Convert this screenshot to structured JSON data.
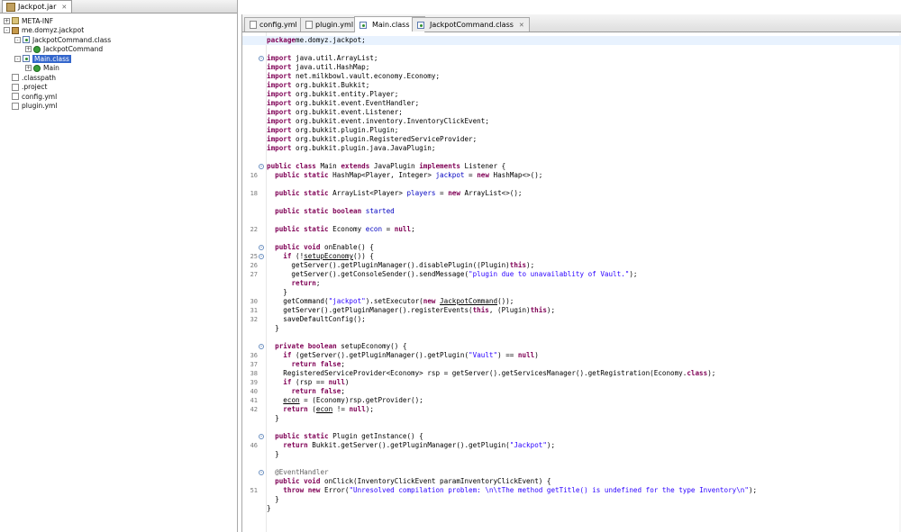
{
  "left_tab": {
    "label": "Jackpot.jar"
  },
  "tree": [
    {
      "label": "META-INF",
      "depth": 0,
      "icon": "package-folder-icon",
      "expander": "+"
    },
    {
      "label": "me.domyz.jackpot",
      "depth": 0,
      "icon": "package-icon",
      "expander": "-"
    },
    {
      "label": "JackpotCommand.class",
      "depth": 1,
      "icon": "class-file-icon",
      "expander": "-"
    },
    {
      "label": "JackpotCommand",
      "depth": 2,
      "icon": "class-icon",
      "expander": "+"
    },
    {
      "label": "Main.class",
      "depth": 1,
      "icon": "class-file-icon",
      "expander": "-",
      "selected": true
    },
    {
      "label": "Main",
      "depth": 2,
      "icon": "class-icon",
      "expander": "+"
    },
    {
      "label": ".classpath",
      "depth": 0,
      "icon": "file-icon",
      "expander": ""
    },
    {
      "label": ".project",
      "depth": 0,
      "icon": "file-icon",
      "expander": ""
    },
    {
      "label": "config.yml",
      "depth": 0,
      "icon": "file-icon",
      "expander": ""
    },
    {
      "label": "plugin.yml",
      "depth": 0,
      "icon": "file-icon",
      "expander": ""
    }
  ],
  "editor_tabs": [
    {
      "label": "config.yml",
      "active": false
    },
    {
      "label": "plugin.yml",
      "active": false
    },
    {
      "label": "Main.class",
      "active": true
    },
    {
      "label": "JackpotCommand.class",
      "active": false
    }
  ],
  "code_lines": [
    {
      "n": "",
      "fold": "",
      "hl": true,
      "segs": [
        [
          "kw",
          "package"
        ],
        [
          "",
          "me.domyz.jackpot;"
        ]
      ]
    },
    {
      "n": "",
      "fold": "",
      "segs": []
    },
    {
      "n": "",
      "fold": "-",
      "segs": [
        [
          "kw",
          "import"
        ],
        [
          "",
          " java.util.ArrayList;"
        ]
      ]
    },
    {
      "n": "",
      "fold": "",
      "segs": [
        [
          "kw",
          "import"
        ],
        [
          "",
          " java.util.HashMap;"
        ]
      ]
    },
    {
      "n": "",
      "fold": "",
      "segs": [
        [
          "kw",
          "import"
        ],
        [
          "",
          " net.milkbowl.vault.economy.Economy;"
        ]
      ]
    },
    {
      "n": "",
      "fold": "",
      "segs": [
        [
          "kw",
          "import"
        ],
        [
          "",
          " org.bukkit.Bukkit;"
        ]
      ]
    },
    {
      "n": "",
      "fold": "",
      "segs": [
        [
          "kw",
          "import"
        ],
        [
          "",
          " org.bukkit.entity.Player;"
        ]
      ]
    },
    {
      "n": "",
      "fold": "",
      "segs": [
        [
          "kw",
          "import"
        ],
        [
          "",
          " org.bukkit.event.EventHandler;"
        ]
      ]
    },
    {
      "n": "",
      "fold": "",
      "segs": [
        [
          "kw",
          "import"
        ],
        [
          "",
          " org.bukkit.event.Listener;"
        ]
      ]
    },
    {
      "n": "",
      "fold": "",
      "segs": [
        [
          "kw",
          "import"
        ],
        [
          "",
          " org.bukkit.event.inventory.InventoryClickEvent;"
        ]
      ]
    },
    {
      "n": "",
      "fold": "",
      "segs": [
        [
          "kw",
          "import"
        ],
        [
          "",
          " org.bukkit.plugin.Plugin;"
        ]
      ]
    },
    {
      "n": "",
      "fold": "",
      "segs": [
        [
          "kw",
          "import"
        ],
        [
          "",
          " org.bukkit.plugin.RegisteredServiceProvider;"
        ]
      ]
    },
    {
      "n": "",
      "fold": "",
      "segs": [
        [
          "kw",
          "import"
        ],
        [
          "",
          " org.bukkit.plugin.java.JavaPlugin;"
        ]
      ]
    },
    {
      "n": "",
      "fold": "",
      "segs": []
    },
    {
      "n": "",
      "fold": "-",
      "segs": [
        [
          "kw",
          "public class"
        ],
        [
          "",
          " Main "
        ],
        [
          "kw",
          "extends"
        ],
        [
          "",
          " JavaPlugin "
        ],
        [
          "kw",
          "implements"
        ],
        [
          "",
          " Listener {"
        ]
      ]
    },
    {
      "n": "16",
      "fold": "",
      "segs": [
        [
          "",
          "  "
        ],
        [
          "kw",
          "public static"
        ],
        [
          "",
          " HashMap<Player, Integer> "
        ],
        [
          "fld",
          "jackpot"
        ],
        [
          "",
          " = "
        ],
        [
          "kw",
          "new"
        ],
        [
          "",
          " HashMap<>();"
        ]
      ]
    },
    {
      "n": "",
      "fold": "",
      "segs": []
    },
    {
      "n": "18",
      "fold": "",
      "segs": [
        [
          "",
          "  "
        ],
        [
          "kw",
          "public static"
        ],
        [
          "",
          " ArrayList<Player> "
        ],
        [
          "fld",
          "players"
        ],
        [
          "",
          " = "
        ],
        [
          "kw",
          "new"
        ],
        [
          "",
          " ArrayList<>();"
        ]
      ]
    },
    {
      "n": "",
      "fold": "",
      "segs": []
    },
    {
      "n": "",
      "fold": "",
      "segs": [
        [
          "",
          "  "
        ],
        [
          "kw",
          "public static boolean"
        ],
        [
          "",
          " "
        ],
        [
          "fld",
          "started"
        ],
        [
          ";",
          " "
        ]
      ]
    },
    {
      "n": "",
      "fold": "",
      "segs": []
    },
    {
      "n": "22",
      "fold": "",
      "segs": [
        [
          "",
          "  "
        ],
        [
          "kw",
          "public static"
        ],
        [
          "",
          " Economy "
        ],
        [
          "fld",
          "econ"
        ],
        [
          "",
          " = "
        ],
        [
          "kw",
          "null"
        ],
        [
          "",
          ";"
        ]
      ]
    },
    {
      "n": "",
      "fold": "",
      "segs": []
    },
    {
      "n": "",
      "fold": "-",
      "segs": [
        [
          "",
          "  "
        ],
        [
          "kw",
          "public void"
        ],
        [
          "",
          " onEnable() {"
        ]
      ]
    },
    {
      "n": "25",
      "fold": "-",
      "segs": [
        [
          "",
          "    "
        ],
        [
          "kw",
          "if"
        ],
        [
          "",
          " (!"
        ],
        [
          "ul",
          "setupEconomy"
        ],
        [
          "",
          "()) {"
        ]
      ]
    },
    {
      "n": "26",
      "fold": "",
      "segs": [
        [
          "",
          "      getServer().getPluginManager().disablePlugin((Plugin)"
        ],
        [
          "kw",
          "this"
        ],
        [
          "",
          ");"
        ]
      ]
    },
    {
      "n": "27",
      "fold": "",
      "segs": [
        [
          "",
          "      getServer().getConsoleSender().sendMessage("
        ],
        [
          "str",
          "\"plugin due to unavailablity of Vault.\""
        ],
        [
          "",
          ");"
        ]
      ]
    },
    {
      "n": "",
      "fold": "",
      "segs": [
        [
          "",
          "      "
        ],
        [
          "kw",
          "return"
        ],
        [
          "",
          ";"
        ]
      ]
    },
    {
      "n": "",
      "fold": "",
      "segs": [
        [
          "",
          "    }"
        ]
      ]
    },
    {
      "n": "30",
      "fold": "",
      "segs": [
        [
          "",
          "    getCommand("
        ],
        [
          "str",
          "\"jackpot\""
        ],
        [
          "",
          ").setExecutor("
        ],
        [
          "kw",
          "new"
        ],
        [
          "",
          " "
        ],
        [
          "ul",
          "JackpotCommand"
        ],
        [
          "",
          "());"
        ]
      ]
    },
    {
      "n": "31",
      "fold": "",
      "segs": [
        [
          "",
          "    getServer().getPluginManager().registerEvents("
        ],
        [
          "kw",
          "this"
        ],
        [
          "",
          ", (Plugin)"
        ],
        [
          "kw",
          "this"
        ],
        [
          "",
          ");"
        ]
      ]
    },
    {
      "n": "32",
      "fold": "",
      "segs": [
        [
          "",
          "    saveDefaultConfig();"
        ]
      ]
    },
    {
      "n": "",
      "fold": "",
      "segs": [
        [
          "",
          "  }"
        ]
      ]
    },
    {
      "n": "",
      "fold": "",
      "segs": []
    },
    {
      "n": "",
      "fold": "-",
      "segs": [
        [
          "",
          "  "
        ],
        [
          "kw",
          "private boolean"
        ],
        [
          "",
          " setupEconomy() {"
        ]
      ]
    },
    {
      "n": "36",
      "fold": "",
      "segs": [
        [
          "",
          "    "
        ],
        [
          "kw",
          "if"
        ],
        [
          "",
          " (getServer().getPluginManager().getPlugin("
        ],
        [
          "str",
          "\"Vault\""
        ],
        [
          "",
          ") == "
        ],
        [
          "kw",
          "null"
        ],
        [
          "",
          ")"
        ]
      ]
    },
    {
      "n": "37",
      "fold": "",
      "segs": [
        [
          "",
          "      "
        ],
        [
          "kw",
          "return false"
        ],
        [
          "",
          ";"
        ]
      ]
    },
    {
      "n": "38",
      "fold": "",
      "segs": [
        [
          "",
          "    RegisteredServiceProvider<Economy> rsp = getServer().getServicesManager().getRegistration(Economy."
        ],
        [
          "kw",
          "class"
        ],
        [
          "",
          ");"
        ]
      ]
    },
    {
      "n": "39",
      "fold": "",
      "segs": [
        [
          "",
          "    "
        ],
        [
          "kw",
          "if"
        ],
        [
          "",
          " (rsp == "
        ],
        [
          "kw",
          "null"
        ],
        [
          "",
          ")"
        ]
      ]
    },
    {
      "n": "40",
      "fold": "",
      "segs": [
        [
          "",
          "      "
        ],
        [
          "kw",
          "return false"
        ],
        [
          "",
          ";"
        ]
      ]
    },
    {
      "n": "41",
      "fold": "",
      "segs": [
        [
          "",
          "    "
        ],
        [
          "ul",
          "econ"
        ],
        [
          "",
          " = (Economy)rsp.getProvider();"
        ]
      ]
    },
    {
      "n": "42",
      "fold": "",
      "segs": [
        [
          "",
          "    "
        ],
        [
          "kw",
          "return"
        ],
        [
          "",
          " ("
        ],
        [
          "ul",
          "econ"
        ],
        [
          "",
          " != "
        ],
        [
          "kw",
          "null"
        ],
        [
          "",
          ");"
        ]
      ]
    },
    {
      "n": "",
      "fold": "",
      "segs": [
        [
          "",
          "  }"
        ]
      ]
    },
    {
      "n": "",
      "fold": "",
      "segs": []
    },
    {
      "n": "",
      "fold": "-",
      "segs": [
        [
          "",
          "  "
        ],
        [
          "kw",
          "public static"
        ],
        [
          "",
          " Plugin getInstance() {"
        ]
      ]
    },
    {
      "n": "46",
      "fold": "",
      "segs": [
        [
          "",
          "    "
        ],
        [
          "kw",
          "return"
        ],
        [
          "",
          " Bukkit.getServer().getPluginManager().getPlugin("
        ],
        [
          "str",
          "\"Jackpot\""
        ],
        [
          "",
          ");"
        ]
      ]
    },
    {
      "n": "",
      "fold": "",
      "segs": [
        [
          "",
          "  }"
        ]
      ]
    },
    {
      "n": "",
      "fold": "",
      "segs": []
    },
    {
      "n": "",
      "fold": "-",
      "segs": [
        [
          "",
          "  "
        ],
        [
          "ann",
          "@EventHandler"
        ]
      ]
    },
    {
      "n": "",
      "fold": "",
      "segs": [
        [
          "",
          "  "
        ],
        [
          "kw",
          "public void"
        ],
        [
          "",
          " onClick(InventoryClickEvent paramInventoryClickEvent) {"
        ]
      ]
    },
    {
      "n": "51",
      "fold": "",
      "segs": [
        [
          "",
          "    "
        ],
        [
          "kw",
          "throw new"
        ],
        [
          "",
          " Error("
        ],
        [
          "str",
          "\"Unresolved compilation problem: \\n\\tThe method getTitle() is undefined for the type Inventory\\n\""
        ],
        [
          "",
          ");"
        ]
      ]
    },
    {
      "n": "",
      "fold": "",
      "segs": [
        [
          "",
          "  }"
        ]
      ]
    },
    {
      "n": "",
      "fold": "",
      "segs": [
        [
          "",
          "}"
        ]
      ]
    }
  ]
}
